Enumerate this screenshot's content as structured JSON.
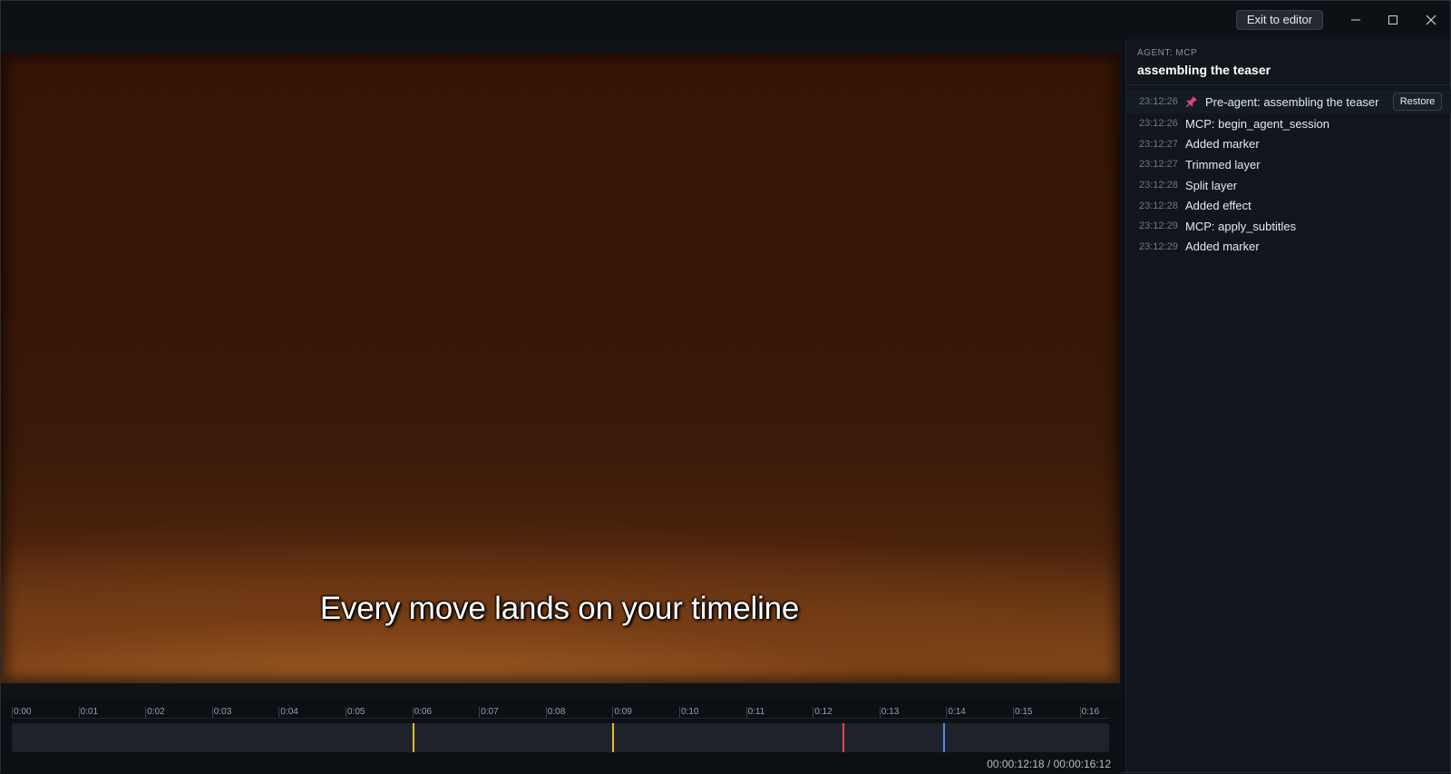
{
  "titlebar": {
    "exit_label": "Exit to editor"
  },
  "preview": {
    "subtitle": "Every move lands on your timeline"
  },
  "timeline": {
    "ticks": [
      "0:00",
      "0:01",
      "0:02",
      "0:03",
      "0:04",
      "0:05",
      "0:06",
      "0:07",
      "0:08",
      "0:09",
      "0:10",
      "0:11",
      "0:12",
      "0:13",
      "0:14",
      "0:15",
      "0:16"
    ],
    "duration_seconds": 16.5,
    "markers": [
      {
        "time_seconds": 6.0,
        "color": "#e8b923"
      },
      {
        "time_seconds": 9.0,
        "color": "#e8b923"
      },
      {
        "time_seconds": 12.45,
        "color": "#e5484d"
      },
      {
        "time_seconds": 13.95,
        "color": "#4c8cf0"
      }
    ],
    "timecode": "00:00:12:18 / 00:00:16:12"
  },
  "panel": {
    "kicker": "AGENT: MCP",
    "title": "assembling the teaser",
    "restore_label": "Restore",
    "history": [
      {
        "time": "23:12:26",
        "label": "Pre-agent: assembling the teaser",
        "pinned": true
      },
      {
        "time": "23:12:26",
        "label": "MCP: begin_agent_session"
      },
      {
        "time": "23:12:27",
        "label": "Added marker"
      },
      {
        "time": "23:12:27",
        "label": "Trimmed layer"
      },
      {
        "time": "23:12:28",
        "label": "Split layer"
      },
      {
        "time": "23:12:28",
        "label": "Added effect"
      },
      {
        "time": "23:12:29",
        "label": "MCP: apply_subtitles"
      },
      {
        "time": "23:12:29",
        "label": "Added marker"
      }
    ]
  },
  "colors": {
    "pin": "#e0457b",
    "accent_marker_yellow": "#e8b923",
    "accent_marker_red": "#e5484d",
    "accent_marker_blue": "#4c8cf0"
  }
}
